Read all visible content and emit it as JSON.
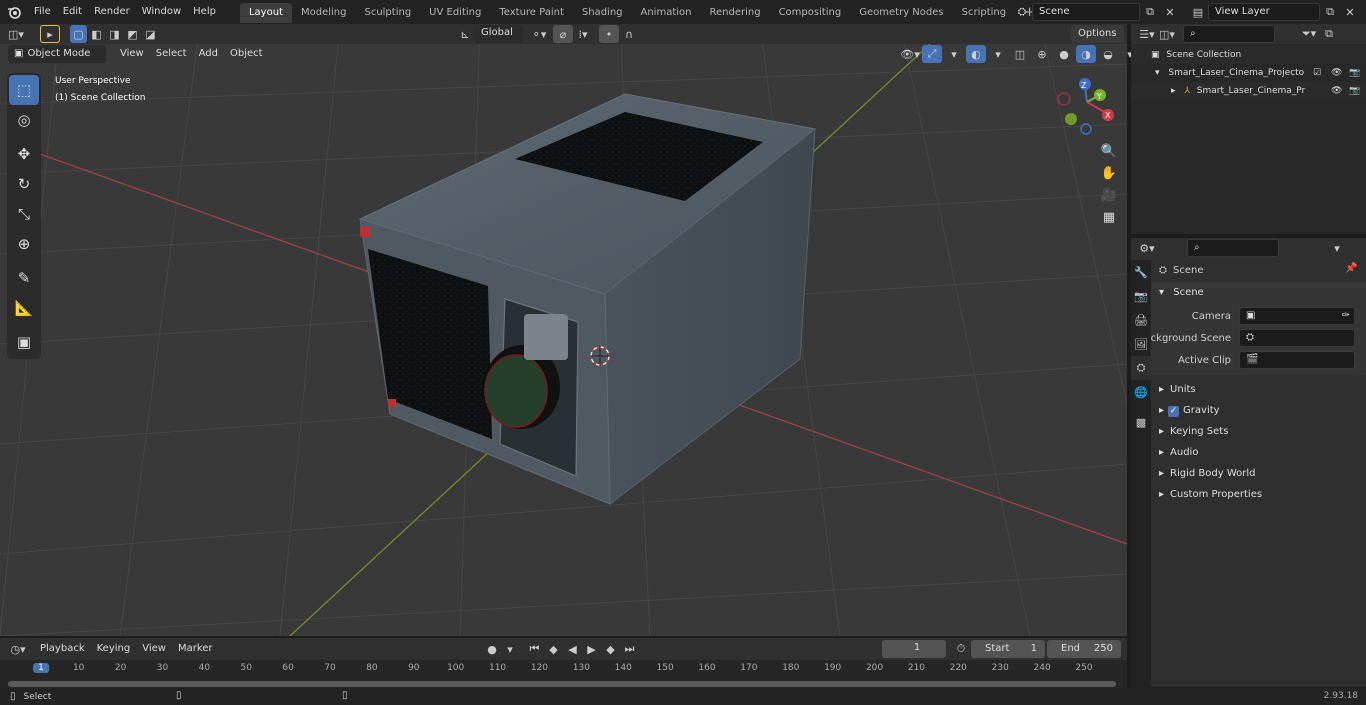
{
  "top_menu": [
    "File",
    "Edit",
    "Render",
    "Window",
    "Help"
  ],
  "workspaces": [
    {
      "label": "Layout",
      "active": true
    },
    {
      "label": "Modeling"
    },
    {
      "label": "Sculpting"
    },
    {
      "label": "UV Editing"
    },
    {
      "label": "Texture Paint"
    },
    {
      "label": "Shading"
    },
    {
      "label": "Animation"
    },
    {
      "label": "Rendering"
    },
    {
      "label": "Compositing"
    },
    {
      "label": "Geometry Nodes"
    },
    {
      "label": "Scripting"
    }
  ],
  "scene_field": "Scene",
  "view_layer_field": "View Layer",
  "viewport": {
    "mode": "Object Mode",
    "menus": [
      "View",
      "Select",
      "Add",
      "Object"
    ],
    "orientation": "Global",
    "options": "Options",
    "overlay_title": "User Perspective",
    "overlay_subtitle": "(1) Scene Collection",
    "gizmo": {
      "x": "X",
      "y": "Y",
      "z": "Z"
    }
  },
  "outliner": {
    "root": "Scene Collection",
    "items": [
      {
        "label": "Smart_Laser_Cinema_Projecto"
      },
      {
        "label": "Smart_Laser_Cinema_Pr"
      }
    ]
  },
  "properties": {
    "header": "Scene",
    "section": "Scene",
    "fields": [
      {
        "label": "Camera"
      },
      {
        "label": "Background Scene"
      },
      {
        "label": "Active Clip"
      }
    ],
    "subpanels": [
      "Units",
      "Gravity",
      "Keying Sets",
      "Audio",
      "Rigid Body World",
      "Custom Properties"
    ]
  },
  "timeline": {
    "menus": [
      "Playback",
      "Keying",
      "View",
      "Marker"
    ],
    "current_frame": "1",
    "start_label": "Start",
    "start_value": "1",
    "end_label": "End",
    "end_value": "250",
    "ruler": [
      "1",
      "10",
      "20",
      "30",
      "40",
      "50",
      "60",
      "70",
      "80",
      "90",
      "100",
      "110",
      "120",
      "130",
      "140",
      "150",
      "160",
      "170",
      "180",
      "190",
      "200",
      "210",
      "220",
      "230",
      "240",
      "250"
    ]
  },
  "status": {
    "left": "Select",
    "version": "2.93.18"
  },
  "colors": {
    "accent": "#4772b3",
    "x_axis": "#b13a45",
    "y_axis": "#7a9c2f",
    "background": "#393939"
  }
}
